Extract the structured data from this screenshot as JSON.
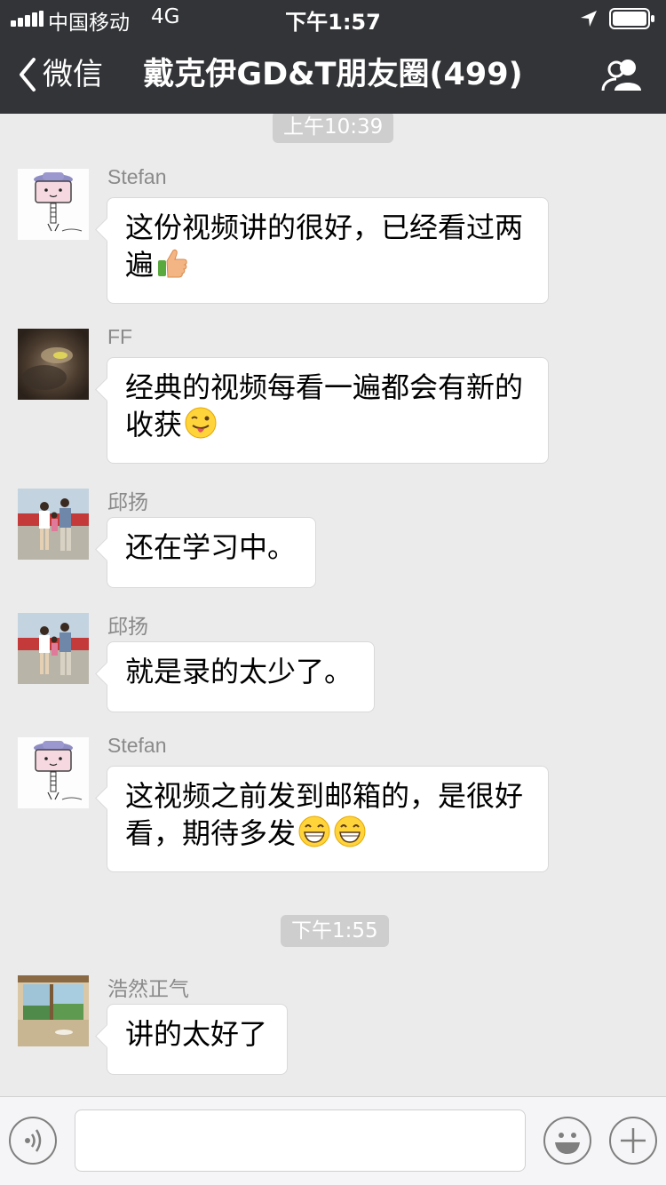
{
  "status_bar": {
    "carrier": "中国移动",
    "network": "4G",
    "time": "下午1:57",
    "icons": [
      "signal-bars-icon",
      "location-arrow-icon",
      "battery-icon"
    ]
  },
  "nav": {
    "back_label": "微信",
    "title": "戴克伊GD&T朋友圈(499)",
    "back_icon": "chevron-left-icon",
    "right_icon": "group-members-icon"
  },
  "chat": {
    "timestamps": [
      "上午10:39",
      "下午1:55"
    ],
    "messages": [
      {
        "sender": "Stefan",
        "line1": "这份视频讲的很好，已经看过两",
        "line2": "遍",
        "emoji": [
          "thumbs-up-icon"
        ]
      },
      {
        "sender": "FF",
        "line1": "经典的视频每看一遍都会有新的",
        "line2": "收获",
        "emoji": [
          "winking-tongue-face-icon"
        ]
      },
      {
        "sender": "邱扬",
        "line1": "还在学习中。"
      },
      {
        "sender": "邱扬",
        "line1": "就是录的太少了。"
      },
      {
        "sender": "Stefan",
        "line1": "这视频之前发到邮箱的，是很好",
        "line2": "看，期待多发",
        "emoji": [
          "grinning-face-icon",
          "grinning-face-icon"
        ]
      },
      {
        "sender": "浩然正气",
        "line1": "讲的太好了"
      }
    ]
  },
  "input_bar": {
    "icons": [
      "voice-icon",
      "emoji-face-icon",
      "plus-icon"
    ],
    "text_value": ""
  },
  "colors": {
    "header_bg": "#333437",
    "chat_bg": "#ebebeb",
    "bubble_bg": "#ffffff",
    "timestamp_bg": "#cecece",
    "sender_text": "#8a8a8a"
  }
}
